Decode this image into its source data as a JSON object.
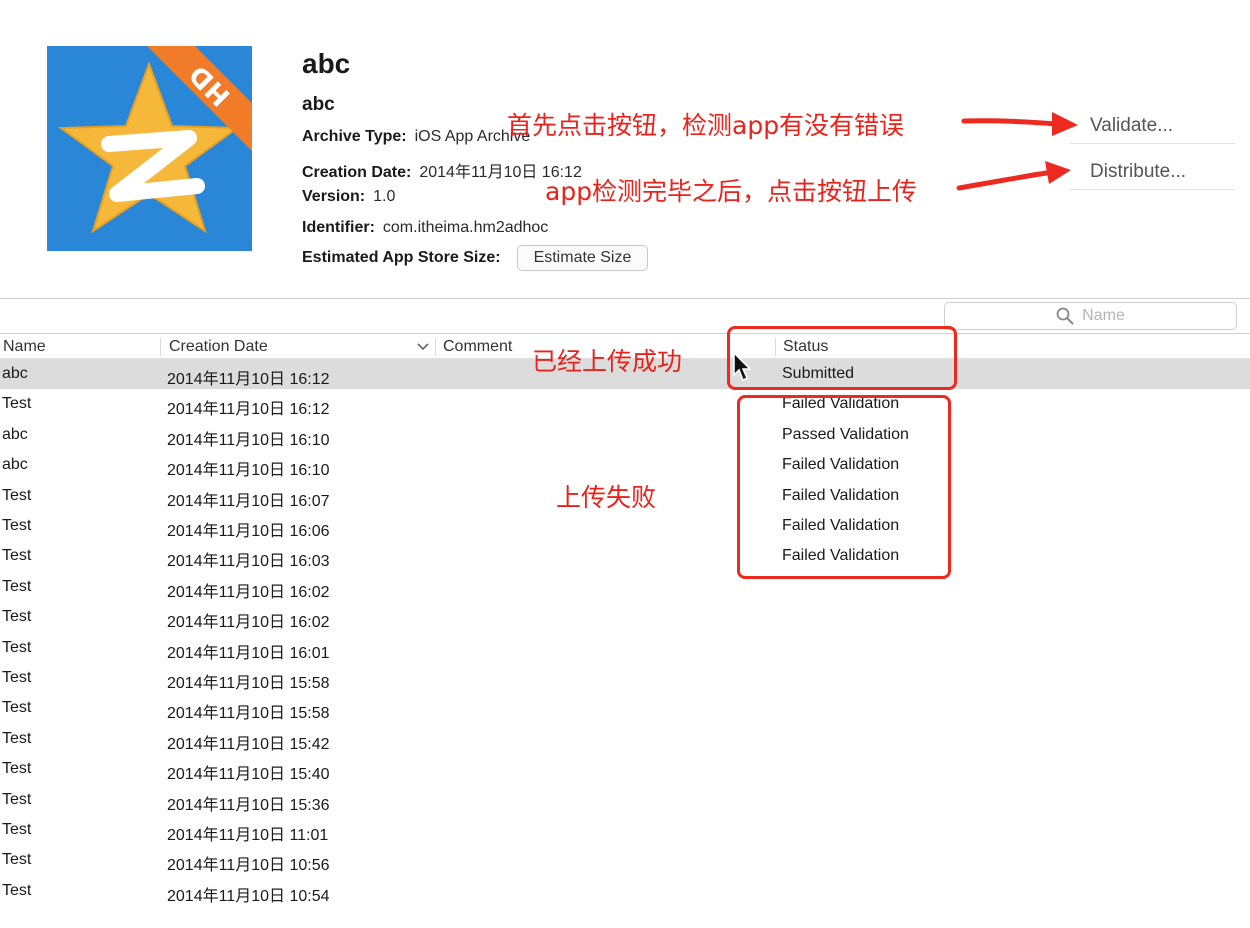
{
  "app": {
    "title": "abc",
    "subtitle": "abc",
    "icon_badge": "HD",
    "archive_type_label": "Archive Type:",
    "archive_type_value": "iOS App Archive",
    "creation_date_label": "Creation Date:",
    "creation_date_value": "2014年11月10日 16:12",
    "version_label": "Version:",
    "version_value": "1.0",
    "identifier_label": "Identifier:",
    "identifier_value": "com.itheima.hm2adhoc",
    "size_label": "Estimated App Store Size:",
    "estimate_button": "Estimate Size"
  },
  "actions": {
    "validate": "Validate...",
    "distribute": "Distribute..."
  },
  "annotations": {
    "validate_note": "首先点击按钮，检测app有没有错误",
    "distribute_note": "app检测完毕之后，点击按钮上传",
    "submitted_note": "已经上传成功",
    "failed_note": "上传失败",
    "color": "#e8231c"
  },
  "search": {
    "placeholder": "Name"
  },
  "table": {
    "columns": {
      "name": "Name",
      "creation_date": "Creation Date",
      "comment": "Comment",
      "status": "Status"
    },
    "rows": [
      {
        "name": "abc",
        "date": "2014年11月10日 16:12",
        "status": "Submitted"
      },
      {
        "name": "Test",
        "date": "2014年11月10日 16:12",
        "status": "Failed Validation"
      },
      {
        "name": "abc",
        "date": "2014年11月10日 16:10",
        "status": "Passed Validation"
      },
      {
        "name": "abc",
        "date": "2014年11月10日 16:10",
        "status": "Failed Validation"
      },
      {
        "name": "Test",
        "date": "2014年11月10日 16:07",
        "status": "Failed Validation"
      },
      {
        "name": "Test",
        "date": "2014年11月10日 16:06",
        "status": "Failed Validation"
      },
      {
        "name": "Test",
        "date": "2014年11月10日 16:03",
        "status": "Failed Validation"
      },
      {
        "name": "Test",
        "date": "2014年11月10日 16:02",
        "status": ""
      },
      {
        "name": "Test",
        "date": "2014年11月10日 16:02",
        "status": ""
      },
      {
        "name": "Test",
        "date": "2014年11月10日 16:01",
        "status": ""
      },
      {
        "name": "Test",
        "date": "2014年11月10日 15:58",
        "status": ""
      },
      {
        "name": "Test",
        "date": "2014年11月10日 15:58",
        "status": ""
      },
      {
        "name": "Test",
        "date": "2014年11月10日 15:42",
        "status": ""
      },
      {
        "name": "Test",
        "date": "2014年11月10日 15:40",
        "status": ""
      },
      {
        "name": "Test",
        "date": "2014年11月10日 15:36",
        "status": ""
      },
      {
        "name": "Test",
        "date": "2014年11月10日 11:01",
        "status": ""
      },
      {
        "name": "Test",
        "date": "2014年11月10日 10:56",
        "status": ""
      },
      {
        "name": "Test",
        "date": "2014年11月10日 10:54",
        "status": ""
      }
    ]
  },
  "icons": [
    "app-icon",
    "search-icon",
    "chevron-down-icon",
    "mouse-cursor-icon",
    "arrow-icon"
  ],
  "colors": {
    "selected_row": "#dcdcdc",
    "icon_bg": "#2a86d6",
    "icon_star": "#f6b83a",
    "icon_ribbon": "#f07c2a"
  }
}
